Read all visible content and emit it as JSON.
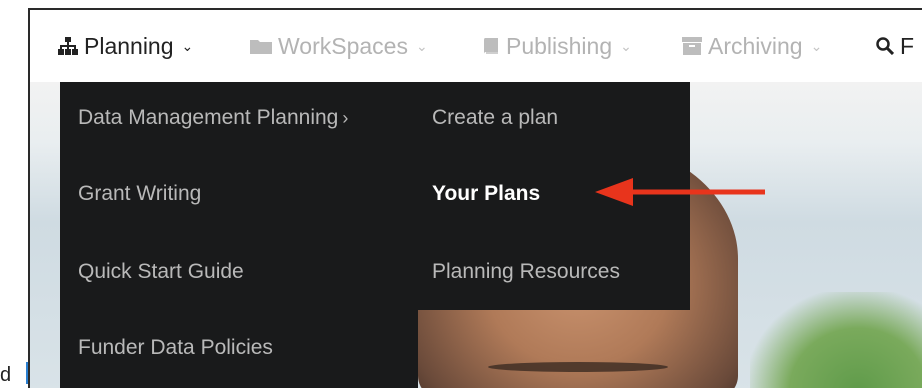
{
  "nav": {
    "items": [
      {
        "label": "Planning",
        "icon": "sitemap-icon",
        "state": "active"
      },
      {
        "label": "WorkSpaces",
        "icon": "folder-icon",
        "state": "muted"
      },
      {
        "label": "Publishing",
        "icon": "book-icon",
        "state": "muted"
      },
      {
        "label": "Archiving",
        "icon": "archive-icon",
        "state": "muted"
      },
      {
        "label": "F",
        "icon": "search-icon",
        "state": "active"
      }
    ]
  },
  "dropdown": {
    "left_items": [
      {
        "label": "Data Management Planning",
        "has_submenu": true,
        "submenu_caret": "›"
      },
      {
        "label": "Grant Writing"
      },
      {
        "label": "Quick Start Guide"
      },
      {
        "label": "Funder Data Policies"
      }
    ],
    "right_items": [
      {
        "label": "Create a plan"
      },
      {
        "label": "Your Plans",
        "selected": true
      },
      {
        "label": "Planning Resources"
      }
    ]
  },
  "annotation": {
    "arrow_color": "#e8341c",
    "points_to": "Your Plans"
  },
  "left_edge_text": "d",
  "colors": {
    "menu_bg": "#191a1b",
    "menu_text": "#b9b9b9",
    "menu_selected_text": "#ffffff",
    "nav_active": "#222222",
    "nav_muted": "#b3b3b3",
    "accent_blue": "#2a7fd0"
  }
}
